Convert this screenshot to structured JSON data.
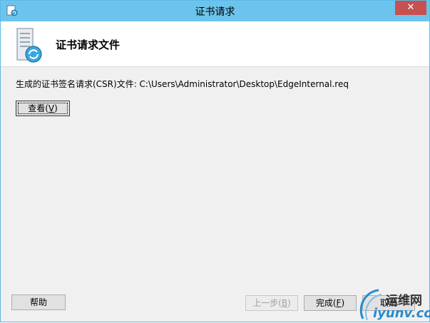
{
  "window": {
    "title": "证书请求",
    "close_label": "✕"
  },
  "header": {
    "title": "证书请求文件",
    "icon": "certificate-document-icon"
  },
  "main": {
    "path_label": "生成的证书签名请求(CSR)文件: C:\\Users\\Administrator\\Desktop\\EdgeInternal.req",
    "view_button": {
      "label": "查看(",
      "mnemonic": "V",
      "suffix": ")"
    }
  },
  "footer": {
    "help_label": "帮助",
    "prev_button": {
      "label": "上一步(",
      "mnemonic": "B",
      "suffix": ")",
      "enabled": false
    },
    "finish_button": {
      "label": "完成(",
      "mnemonic": "F",
      "suffix": ")"
    },
    "cancel_label": "取消"
  },
  "watermark": {
    "line1": "运维网",
    "line2": "iyunv.com"
  },
  "colors": {
    "titlebar": "#6cc4ec",
    "close": "#c75050",
    "body": "#f0f0f0",
    "header": "#ffffff"
  }
}
